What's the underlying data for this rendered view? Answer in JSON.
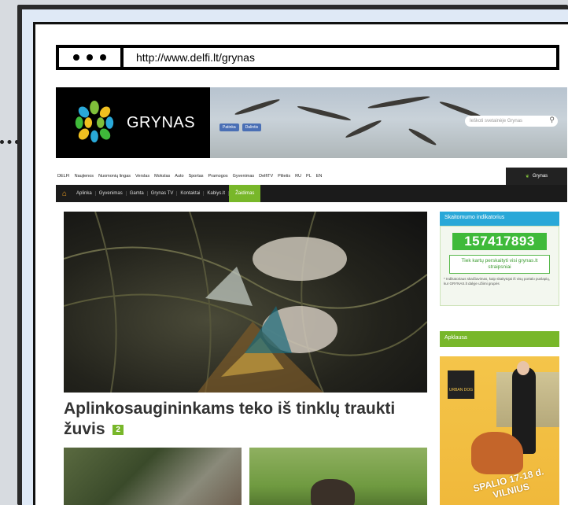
{
  "browser": {
    "url": "http://www.delfi.lt/grynas"
  },
  "header": {
    "logo_text": "GRYNAS",
    "search_placeholder": "Ieškoti svetainėje Grynas",
    "social": [
      "Patinka",
      "Dalintis"
    ]
  },
  "topnav": {
    "items": [
      "DELFI",
      "Naujienos",
      "Nuomonių lingas",
      "Verslas",
      "Mokslas",
      "Auto",
      "Sportas",
      "Pramogos",
      "Gyvenimas",
      "DelfiTV",
      "Pilietis",
      "RU",
      "PL",
      "EN"
    ],
    "active": "Grynas"
  },
  "secnav": {
    "items": [
      "Aplinka",
      "Gyvenimas",
      "Gamta",
      "Grynas TV",
      "Kontaktai",
      "Kabiys.lt"
    ],
    "active": "Žaidimas"
  },
  "main": {
    "headline": "Aplinkosaugininkams teko iš tinklų traukti žuvis",
    "comment_count": "2"
  },
  "sidebar": {
    "counter_title": "Skaitomumo indikatorius",
    "counter_value": "157417893",
    "counter_cta": "Tiek kartų perskaityti visi grynas.lt straipsniai",
    "counter_note": "* Indikatoriaus skaičiavimas, kaip skaitytojai iš visų portalo puslapių, kur GRYNAS.lt dalyje užiimi grupės",
    "poll_title": "Apklausa",
    "ad_logo": "URBAN DOG",
    "ad_text": "SPALIO 17-18 d. VILNIUS"
  },
  "colors": {
    "accent_green": "#78b72a",
    "accent_blue": "#29a8d8",
    "counter_green": "#3fba3a"
  }
}
